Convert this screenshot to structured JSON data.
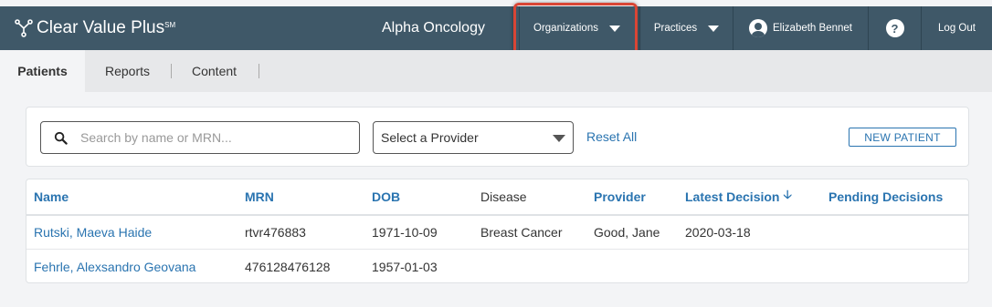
{
  "header": {
    "brand": "Clear Value Plus",
    "brand_mark": "SM",
    "org_name": "Alpha Oncology",
    "organizations_label": "Organizations",
    "practices_label": "Practices",
    "user_name": "Elizabeth Bennet",
    "help_label": "?",
    "logout_label": "Log Out"
  },
  "tabs": [
    {
      "label": "Patients",
      "active": true
    },
    {
      "label": "Reports",
      "active": false
    },
    {
      "label": "Content",
      "active": false
    }
  ],
  "filters": {
    "search_placeholder": "Search by name or MRN...",
    "provider_select": "Select a Provider",
    "reset_label": "Reset All",
    "new_patient_label": "NEW PATIENT"
  },
  "table": {
    "columns": {
      "name": "Name",
      "mrn": "MRN",
      "dob": "DOB",
      "disease": "Disease",
      "provider": "Provider",
      "latest_decision": "Latest Decision",
      "sort_arrow": "🡣",
      "pending_decisions": "Pending Decisions"
    },
    "rows": [
      {
        "name": "Rutski, Maeva Haide",
        "mrn": "rtvr476883",
        "dob": "1971-10-09",
        "disease": "Breast Cancer",
        "provider": "Good, Jane",
        "latest_decision": "2020-03-18",
        "pending_decisions": ""
      },
      {
        "name": "Fehrle, Alexsandro Geovana",
        "mrn": "476128476128",
        "dob": "1957-01-03",
        "disease": "",
        "provider": "",
        "latest_decision": "",
        "pending_decisions": ""
      }
    ]
  },
  "colors": {
    "topbar": "#3f5868",
    "accent": "#2a74b0",
    "highlight": "#d94535"
  }
}
